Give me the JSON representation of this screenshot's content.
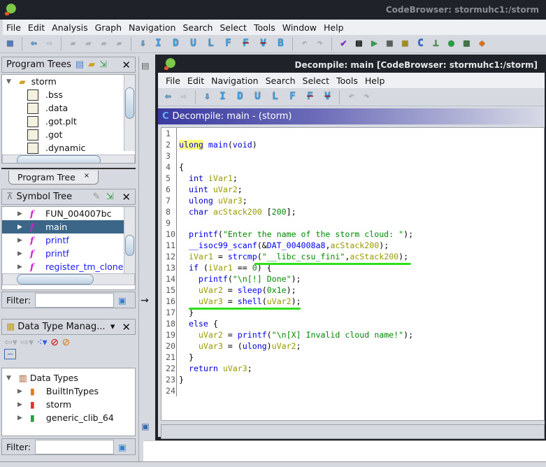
{
  "app": {
    "title": "CodeBrowser: stormuhc1:/storm",
    "menu": [
      "File",
      "Edit",
      "Analysis",
      "Graph",
      "Navigation",
      "Search",
      "Select",
      "Tools",
      "Window",
      "Help"
    ],
    "toolbar_letters": [
      "I",
      "D",
      "U",
      "L",
      "F",
      "F",
      "V",
      "B"
    ]
  },
  "program_trees": {
    "title": "Program Trees",
    "root": "storm",
    "items": [
      ".bss",
      ".data",
      ".got.plt",
      ".got",
      ".dynamic"
    ],
    "tab": "Program Tree",
    "tab_close": "×"
  },
  "symbol_tree": {
    "title": "Symbol Tree",
    "items": [
      {
        "label": "FUN_004007bc",
        "color": "#111111"
      },
      {
        "label": "main",
        "color": "#ffffff",
        "selected": true
      },
      {
        "label": "printf",
        "color": "#1a1aff"
      },
      {
        "label": "printf",
        "color": "#1a1aff"
      },
      {
        "label": "register_tm_clone",
        "color": "#1a1aff"
      }
    ],
    "filter_label": "Filter:",
    "filter_value": ""
  },
  "data_types": {
    "title": "Data Type Manag...",
    "root": "Data Types",
    "items": [
      {
        "label": "BuiltInTypes",
        "color": "#e07a10"
      },
      {
        "label": "storm",
        "color": "#e03030"
      },
      {
        "label": "generic_clib_64",
        "color": "#20a040"
      }
    ],
    "filter_label": "Filter:",
    "filter_value": ""
  },
  "decompile_window": {
    "title": "Decompile: main [CodeBrowser: stormuhc1:/storm]",
    "menu": [
      "File",
      "Edit",
      "Navigation",
      "Search",
      "Select",
      "Tools",
      "Help"
    ],
    "toolbar_letters": [
      "I",
      "D",
      "U",
      "L",
      "F",
      "F",
      "V"
    ],
    "header": "Decompile: main -  (storm)",
    "code": [
      [],
      [
        [
          "ulong",
          "hl"
        ],
        [
          " ",
          "p"
        ],
        [
          "main",
          "f"
        ],
        [
          "(",
          "p"
        ],
        [
          "void",
          "k"
        ],
        [
          ")",
          "p"
        ]
      ],
      [],
      [
        [
          "{",
          "p"
        ]
      ],
      [
        [
          "  ",
          "p"
        ],
        [
          "int",
          "k"
        ],
        [
          " ",
          "p"
        ],
        [
          "iVar1",
          "v"
        ],
        [
          ";",
          "p"
        ]
      ],
      [
        [
          "  ",
          "p"
        ],
        [
          "uint",
          "k"
        ],
        [
          " ",
          "p"
        ],
        [
          "uVar2",
          "v"
        ],
        [
          ";",
          "p"
        ]
      ],
      [
        [
          "  ",
          "p"
        ],
        [
          "ulong",
          "k"
        ],
        [
          " ",
          "p"
        ],
        [
          "uVar3",
          "v"
        ],
        [
          ";",
          "p"
        ]
      ],
      [
        [
          "  ",
          "p"
        ],
        [
          "char",
          "k"
        ],
        [
          " ",
          "p"
        ],
        [
          "acStack200",
          "v"
        ],
        [
          " [",
          "p"
        ],
        [
          "200",
          "n"
        ],
        [
          "];",
          "p"
        ]
      ],
      [],
      [
        [
          "  ",
          "p"
        ],
        [
          "printf",
          "f"
        ],
        [
          "(",
          "p"
        ],
        [
          "\"Enter the name of the storm cloud: \"",
          "s"
        ],
        [
          ");",
          "p"
        ]
      ],
      [
        [
          "  ",
          "p"
        ],
        [
          "__isoc99_scanf",
          "f"
        ],
        [
          "(&",
          "p"
        ],
        [
          "DAT_004008a8",
          "f"
        ],
        [
          ",",
          "p"
        ],
        [
          "acStack200",
          "v"
        ],
        [
          ");",
          "p"
        ]
      ],
      [
        [
          "  ",
          "p"
        ],
        [
          "iVar1",
          "v"
        ],
        [
          " = ",
          "p"
        ],
        [
          "strcmp",
          "f"
        ],
        [
          "(",
          "p"
        ],
        [
          "\"__libc_csu_fini\"",
          "s"
        ],
        [
          ",",
          "p"
        ],
        [
          "acStack200",
          "v"
        ],
        [
          ");",
          "p"
        ]
      ],
      [
        [
          "  ",
          "p"
        ],
        [
          "if",
          "k"
        ],
        [
          " (",
          "p"
        ],
        [
          "iVar1",
          "v"
        ],
        [
          " == ",
          "p"
        ],
        [
          "0",
          "n"
        ],
        [
          ") {",
          "p"
        ]
      ],
      [
        [
          "    ",
          "p"
        ],
        [
          "printf",
          "f"
        ],
        [
          "(",
          "p"
        ],
        [
          "\"\\n[!] Done\"",
          "s"
        ],
        [
          ");",
          "p"
        ]
      ],
      [
        [
          "    ",
          "p"
        ],
        [
          "uVar2",
          "v"
        ],
        [
          " = ",
          "p"
        ],
        [
          "sleep",
          "f"
        ],
        [
          "(",
          "p"
        ],
        [
          "0x1e",
          "n"
        ],
        [
          ");",
          "p"
        ]
      ],
      [
        [
          "    ",
          "p"
        ],
        [
          "uVar3",
          "v"
        ],
        [
          " = ",
          "p"
        ],
        [
          "shell",
          "f"
        ],
        [
          "(",
          "p"
        ],
        [
          "uVar2",
          "v"
        ],
        [
          ");",
          "p"
        ]
      ],
      [
        [
          "  }",
          "p"
        ]
      ],
      [
        [
          "  ",
          "p"
        ],
        [
          "else",
          "k"
        ],
        [
          " {",
          "p"
        ]
      ],
      [
        [
          "    ",
          "p"
        ],
        [
          "uVar2",
          "v"
        ],
        [
          " = ",
          "p"
        ],
        [
          "printf",
          "f"
        ],
        [
          "(",
          "p"
        ],
        [
          "\"\\n[X] Invalid cloud name!\"",
          "s"
        ],
        [
          ");",
          "p"
        ]
      ],
      [
        [
          "    ",
          "p"
        ],
        [
          "uVar3",
          "v"
        ],
        [
          " = (",
          "p"
        ],
        [
          "ulong",
          "k"
        ],
        [
          ")",
          "p"
        ],
        [
          "uVar2",
          "v"
        ],
        [
          ";",
          "p"
        ]
      ],
      [
        [
          "  }",
          "p"
        ]
      ],
      [
        [
          "  ",
          "p"
        ],
        [
          "return",
          "k"
        ],
        [
          " ",
          "p"
        ],
        [
          "uVar3",
          "v"
        ],
        [
          ";",
          "p"
        ]
      ],
      [
        [
          "}",
          "p"
        ]
      ],
      []
    ]
  },
  "colors": {
    "keyword": "#0000c8",
    "function": "#0000ff",
    "variable": "#9a9a00",
    "string": "#008a00",
    "annotation": "#2ee01a",
    "selection": "#3b6687"
  }
}
